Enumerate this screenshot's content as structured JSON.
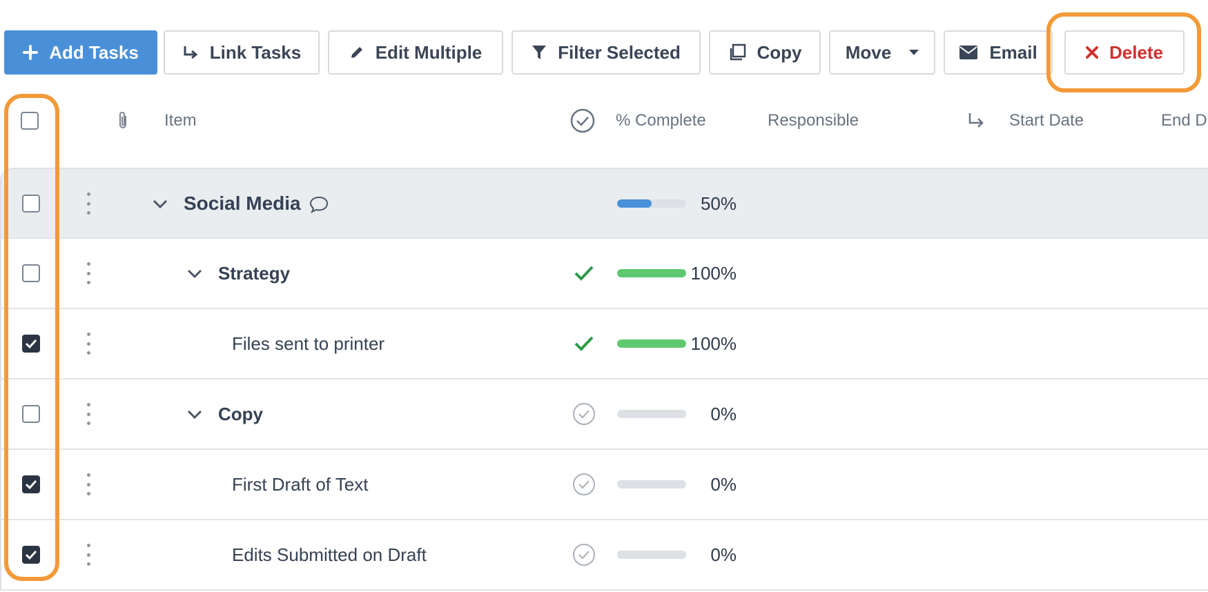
{
  "toolbar": {
    "add_tasks": "Add Tasks",
    "link_tasks": "Link Tasks",
    "edit_multiple": "Edit Multiple",
    "filter_selected": "Filter Selected",
    "copy": "Copy",
    "move": "Move",
    "email": "Email",
    "delete": "Delete"
  },
  "table": {
    "headers": {
      "item": "Item",
      "percent_complete": "% Complete",
      "responsible": "Responsible",
      "start_date": "Start Date",
      "end_date": "End D"
    },
    "rows": [
      {
        "name": "Social Media",
        "percent": "50%",
        "progress": 0.5,
        "checked": false,
        "status": "none",
        "expanded": true,
        "has_comment": true
      },
      {
        "name": "Strategy",
        "percent": "100%",
        "progress": 1.0,
        "checked": false,
        "status": "done",
        "expanded": true
      },
      {
        "name": "Files sent to printer",
        "percent": "100%",
        "progress": 1.0,
        "checked": true,
        "status": "done"
      },
      {
        "name": "Copy",
        "percent": "0%",
        "progress": 0.0,
        "checked": false,
        "status": "open",
        "expanded": true
      },
      {
        "name": "First Draft of Text",
        "percent": "0%",
        "progress": 0.0,
        "checked": true,
        "status": "open"
      },
      {
        "name": "Edits Submitted on Draft",
        "percent": "0%",
        "progress": 0.0,
        "checked": true,
        "status": "open"
      }
    ]
  },
  "colors": {
    "primary": "#4a90d9",
    "danger": "#d0312d",
    "highlight": "#f29a38",
    "progress_partial": "#4a90d9",
    "progress_complete": "#5fc96f",
    "done_check": "#2e9a4a"
  },
  "icons": {
    "add": "plus-icon",
    "link": "link-arrow-icon",
    "edit": "pencil-icon",
    "filter": "filter-icon",
    "copy": "copy-icon",
    "email": "envelope-icon",
    "delete": "x-icon",
    "attachment": "paperclip-icon",
    "status": "circle-check-icon",
    "dependency": "dependency-arrow-icon"
  }
}
